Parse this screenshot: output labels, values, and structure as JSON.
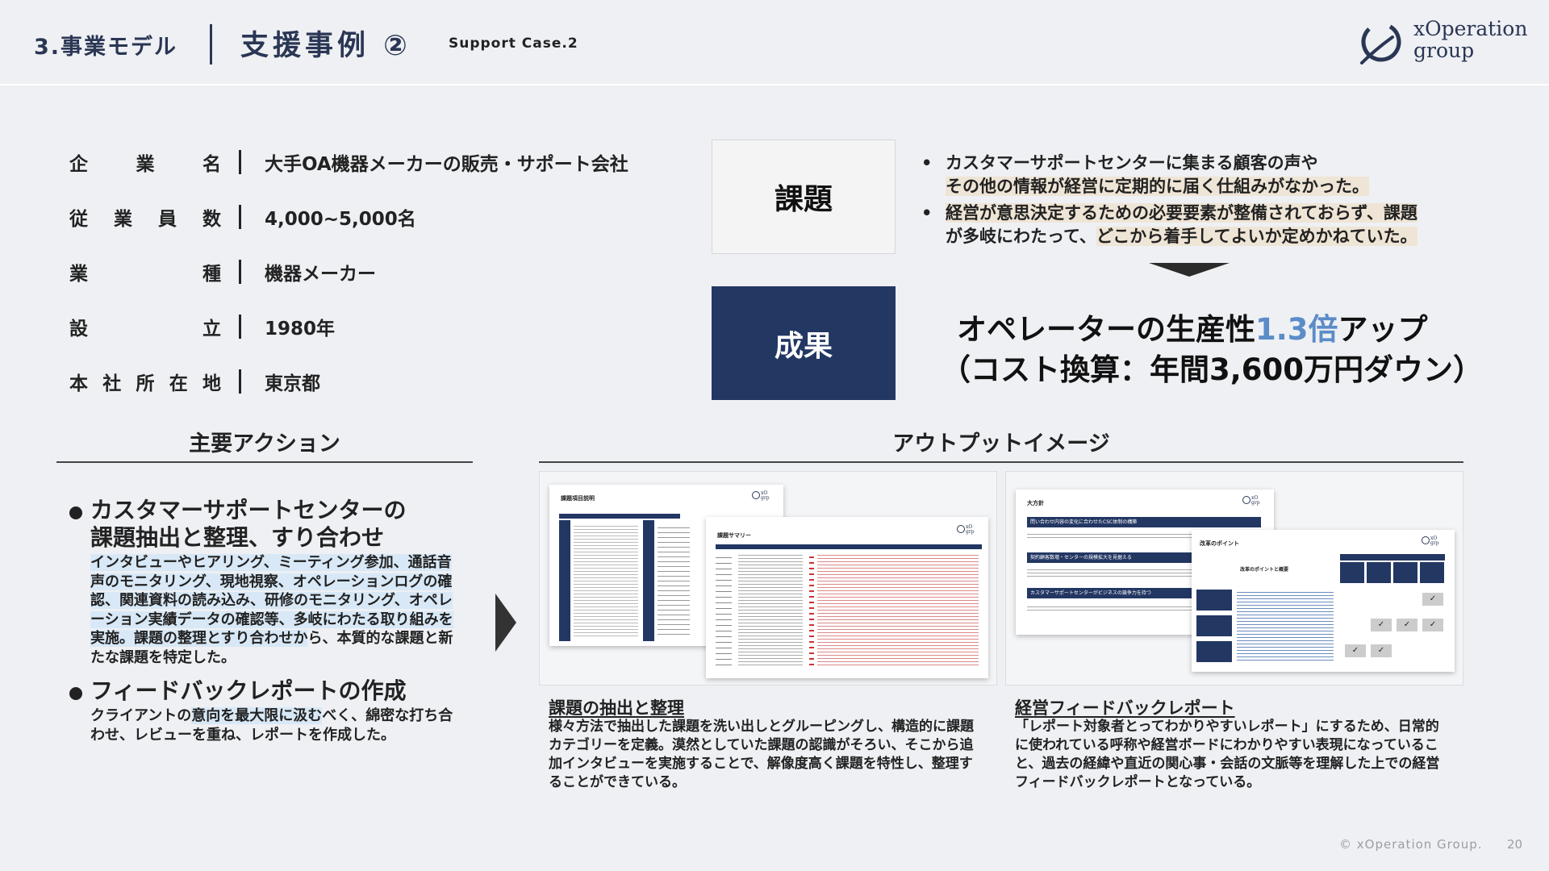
{
  "header": {
    "section": "3.事業モデル",
    "title": "支援事例 ②",
    "subtitle": "Support Case.2",
    "logo_line1": "xOperation",
    "logo_line2": "group"
  },
  "company": [
    {
      "label": [
        "企",
        "業",
        "名"
      ],
      "value": "大手OA機器メーカーの販売・サポート会社"
    },
    {
      "label": [
        "従",
        "業",
        "員",
        "数"
      ],
      "value": "4,000~5,000名"
    },
    {
      "label": [
        "業",
        "種"
      ],
      "value": "機器メーカー"
    },
    {
      "label": [
        "設",
        "立"
      ],
      "value": "1980年"
    },
    {
      "label": [
        "本",
        "社",
        "所",
        "在",
        "地"
      ],
      "value": "東京都"
    }
  ],
  "issue": {
    "label": "課題",
    "items": [
      {
        "line1": "カスタマーサポートセンターに集まる顧客の声や",
        "line2": "その他の情報が経営に定期的に届く仕組みがなかった。"
      },
      {
        "line1": "経営が意思決定するための必要要素が整備されておらず、課題",
        "line2_pre": "が多岐にわたって、",
        "line2": "どこから着手してよいか定めかねていた。"
      }
    ]
  },
  "result": {
    "label": "成果",
    "line1_pre": "オペレーターの生産性",
    "line1_accent": "1.3倍",
    "line1_post": "アップ",
    "line2": "（コスト換算：年間3,600万円ダウン）"
  },
  "actions": {
    "heading": "主要アクション",
    "items": [
      {
        "title1": "カスタマーサポートセンターの",
        "title2": "課題抽出と整理、すり合わせ",
        "desc_hl": "インタビューやヒアリング、ミーティング参加、通話音声のモニタリング、現地視察、オペレーションログの確認、関連資料の読み込み、研修のモニタリング、オペレーション実績データの確認等、多岐にわたる取り組みを実施。",
        "desc_hl2": "課題の整理とすり合わせか",
        "desc_rest": "ら、本質的な課題と新たな課題を特定した。"
      },
      {
        "title1": "フィードバックレポートの作成",
        "desc_pre": "クライアントの",
        "desc_hl": "意向を最大限に汲む",
        "desc_rest": "べく、綿密な打ち合わせ、レビューを重ね、レポートを作成した。"
      }
    ]
  },
  "output": {
    "heading": "アウトプットイメージ",
    "left": {
      "slide1_title": "課題項目説明",
      "slide2_title": "課題サマリー",
      "caption_title": "課題の抽出と整理",
      "caption": "様々方法で抽出した課題を洗い出しとグルーピングし、構造的に課題カテゴリーを定義。漠然としていた課題の認識がそろい、そこから追加インタビューを実施することで、解像度高く課題を特性し、整理することができている。"
    },
    "right": {
      "slide1_title": "大方針",
      "slide1_band1": "問い合わせ内容の変化に合わせたCSC体制の構築",
      "slide1_band2": "契約顧客数増・センターの規模拡大を見据える",
      "slide1_band3": "カスタマーサポートセンターがビジネスの競争力を持つ",
      "slide2_title": "改革のポイント",
      "slide2_sub": "改革のポイントと概要",
      "caption_title": "経営フィードバックレポート",
      "caption": "「レポート対象者とってわかりやすいレポート」にするため、日常的に使われている呼称や経営ボードにわかりやすい表現になっていること、過去の経緯や直近の関心事・会話の文脈等を理解した上での経営フィードバックレポートとなっている。"
    }
  },
  "footer": {
    "copyright": "© xOperation Group.",
    "page": "20"
  },
  "colors": {
    "navy": "#233763",
    "accent_blue": "#5b8cc8",
    "highlight_beige": "#efe5d6",
    "highlight_blue": "#d8e8f6"
  }
}
